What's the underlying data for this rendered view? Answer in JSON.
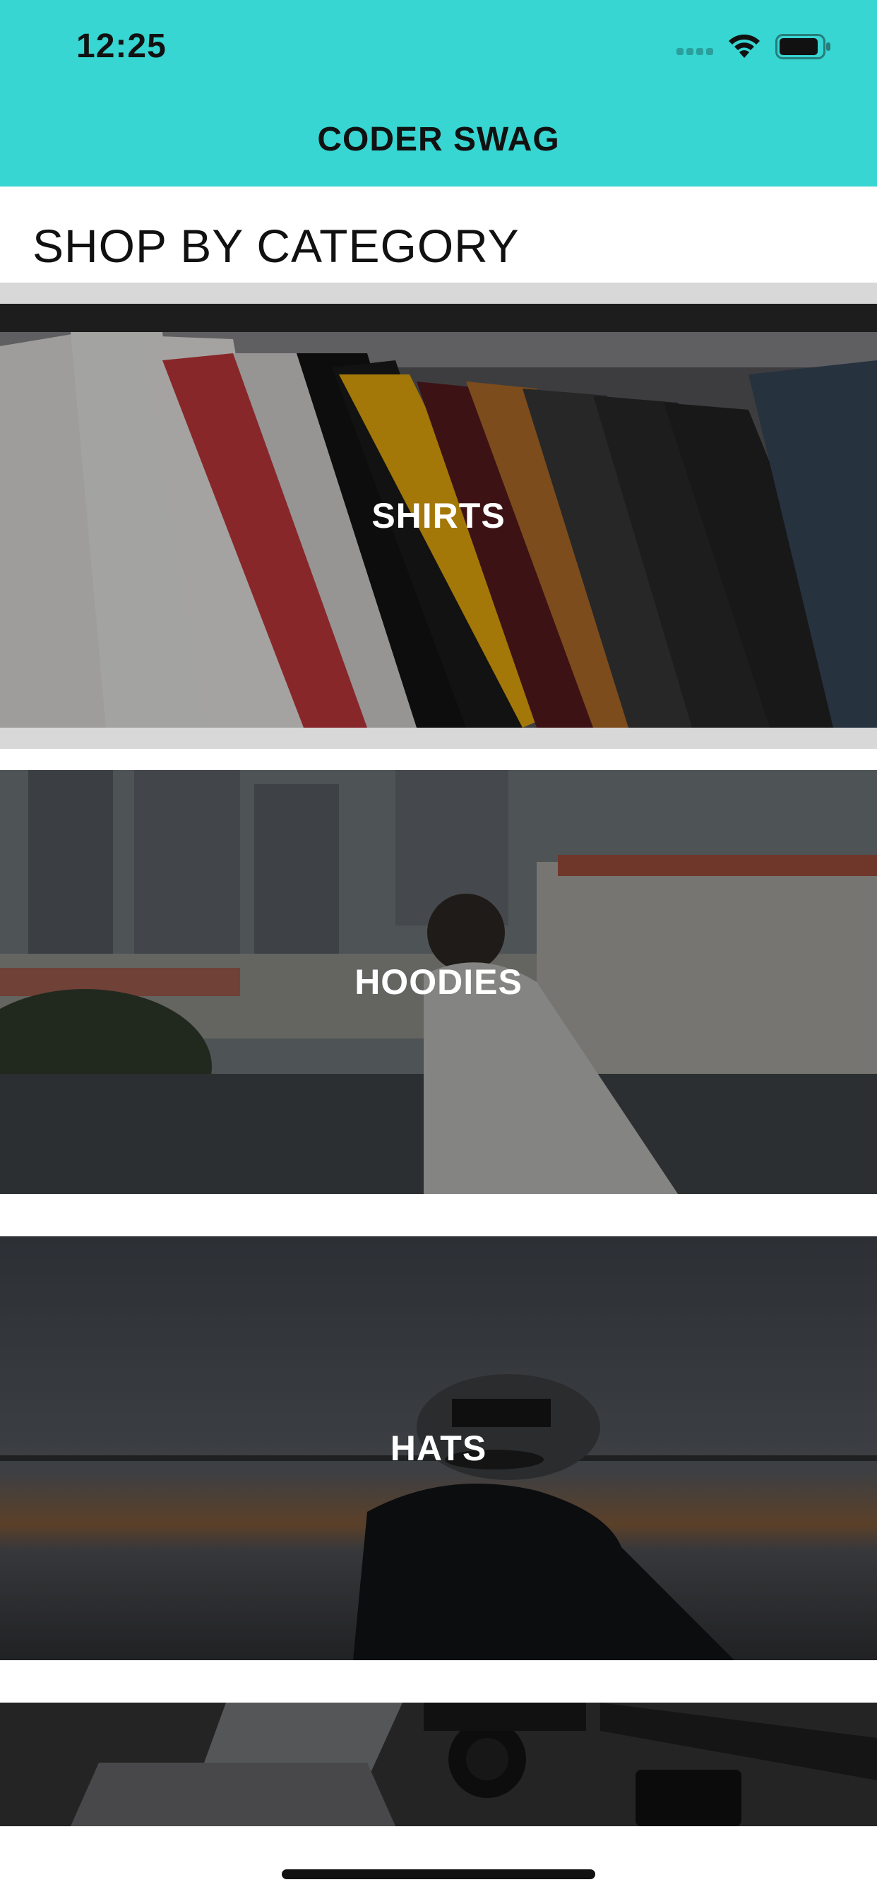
{
  "status_bar": {
    "time": "12:25"
  },
  "header": {
    "title": "CODER SWAG",
    "background": "#37d6d2"
  },
  "section": {
    "title": "SHOP BY CATEGORY"
  },
  "categories": [
    {
      "label": "SHIRTS"
    },
    {
      "label": "HOODIES"
    },
    {
      "label": "HATS"
    },
    {
      "label": ""
    }
  ],
  "icons": [
    "signal-icon",
    "wifi-icon",
    "battery-icon"
  ]
}
